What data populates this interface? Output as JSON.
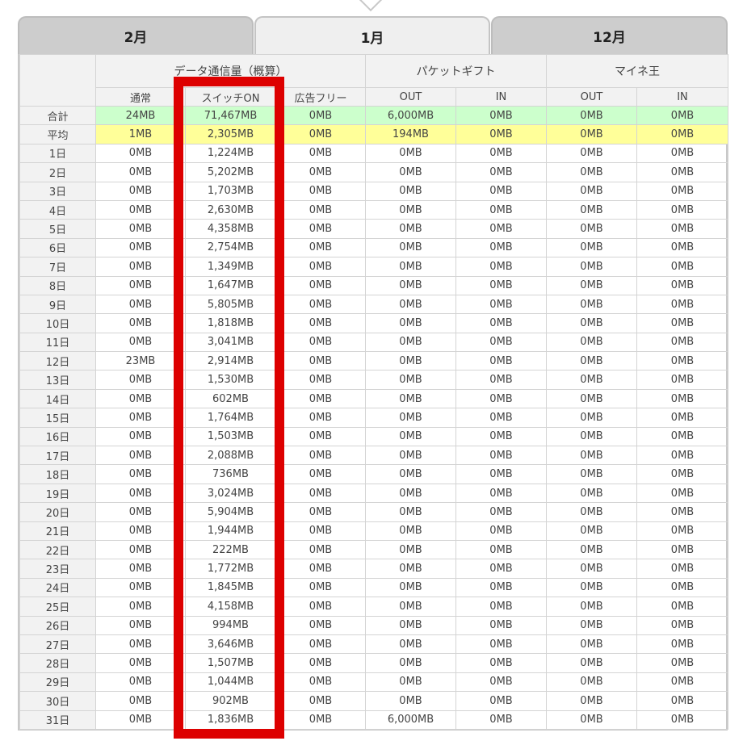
{
  "tabs": [
    {
      "label": "2月",
      "active": false
    },
    {
      "label": "1月",
      "active": true
    },
    {
      "label": "12月",
      "active": false
    }
  ],
  "groups": {
    "data": "データ通信量（概算）",
    "gift": "パケットギフト",
    "mine": "マイネ王"
  },
  "columns": [
    "通常",
    "スイッチON",
    "広告フリー",
    "OUT",
    "IN",
    "OUT",
    "IN"
  ],
  "rows": [
    {
      "label": "合計",
      "kind": "total",
      "values": [
        "24MB",
        "71,467MB",
        "0MB",
        "6,000MB",
        "0MB",
        "0MB",
        "0MB"
      ]
    },
    {
      "label": "平均",
      "kind": "avg",
      "values": [
        "1MB",
        "2,305MB",
        "0MB",
        "194MB",
        "0MB",
        "0MB",
        "0MB"
      ]
    },
    {
      "label": "1日",
      "values": [
        "0MB",
        "1,224MB",
        "0MB",
        "0MB",
        "0MB",
        "0MB",
        "0MB"
      ]
    },
    {
      "label": "2日",
      "values": [
        "0MB",
        "5,202MB",
        "0MB",
        "0MB",
        "0MB",
        "0MB",
        "0MB"
      ]
    },
    {
      "label": "3日",
      "values": [
        "0MB",
        "1,703MB",
        "0MB",
        "0MB",
        "0MB",
        "0MB",
        "0MB"
      ]
    },
    {
      "label": "4日",
      "values": [
        "0MB",
        "2,630MB",
        "0MB",
        "0MB",
        "0MB",
        "0MB",
        "0MB"
      ]
    },
    {
      "label": "5日",
      "values": [
        "0MB",
        "4,358MB",
        "0MB",
        "0MB",
        "0MB",
        "0MB",
        "0MB"
      ]
    },
    {
      "label": "6日",
      "values": [
        "0MB",
        "2,754MB",
        "0MB",
        "0MB",
        "0MB",
        "0MB",
        "0MB"
      ]
    },
    {
      "label": "7日",
      "values": [
        "0MB",
        "1,349MB",
        "0MB",
        "0MB",
        "0MB",
        "0MB",
        "0MB"
      ]
    },
    {
      "label": "8日",
      "values": [
        "0MB",
        "1,647MB",
        "0MB",
        "0MB",
        "0MB",
        "0MB",
        "0MB"
      ]
    },
    {
      "label": "9日",
      "values": [
        "0MB",
        "5,805MB",
        "0MB",
        "0MB",
        "0MB",
        "0MB",
        "0MB"
      ]
    },
    {
      "label": "10日",
      "values": [
        "0MB",
        "1,818MB",
        "0MB",
        "0MB",
        "0MB",
        "0MB",
        "0MB"
      ]
    },
    {
      "label": "11日",
      "values": [
        "0MB",
        "3,041MB",
        "0MB",
        "0MB",
        "0MB",
        "0MB",
        "0MB"
      ]
    },
    {
      "label": "12日",
      "values": [
        "23MB",
        "2,914MB",
        "0MB",
        "0MB",
        "0MB",
        "0MB",
        "0MB"
      ]
    },
    {
      "label": "13日",
      "values": [
        "0MB",
        "1,530MB",
        "0MB",
        "0MB",
        "0MB",
        "0MB",
        "0MB"
      ]
    },
    {
      "label": "14日",
      "values": [
        "0MB",
        "602MB",
        "0MB",
        "0MB",
        "0MB",
        "0MB",
        "0MB"
      ]
    },
    {
      "label": "15日",
      "values": [
        "0MB",
        "1,764MB",
        "0MB",
        "0MB",
        "0MB",
        "0MB",
        "0MB"
      ]
    },
    {
      "label": "16日",
      "values": [
        "0MB",
        "1,503MB",
        "0MB",
        "0MB",
        "0MB",
        "0MB",
        "0MB"
      ]
    },
    {
      "label": "17日",
      "values": [
        "0MB",
        "2,088MB",
        "0MB",
        "0MB",
        "0MB",
        "0MB",
        "0MB"
      ]
    },
    {
      "label": "18日",
      "values": [
        "0MB",
        "736MB",
        "0MB",
        "0MB",
        "0MB",
        "0MB",
        "0MB"
      ]
    },
    {
      "label": "19日",
      "values": [
        "0MB",
        "3,024MB",
        "0MB",
        "0MB",
        "0MB",
        "0MB",
        "0MB"
      ]
    },
    {
      "label": "20日",
      "values": [
        "0MB",
        "5,904MB",
        "0MB",
        "0MB",
        "0MB",
        "0MB",
        "0MB"
      ]
    },
    {
      "label": "21日",
      "values": [
        "0MB",
        "1,944MB",
        "0MB",
        "0MB",
        "0MB",
        "0MB",
        "0MB"
      ]
    },
    {
      "label": "22日",
      "values": [
        "0MB",
        "222MB",
        "0MB",
        "0MB",
        "0MB",
        "0MB",
        "0MB"
      ]
    },
    {
      "label": "23日",
      "values": [
        "0MB",
        "1,772MB",
        "0MB",
        "0MB",
        "0MB",
        "0MB",
        "0MB"
      ]
    },
    {
      "label": "24日",
      "values": [
        "0MB",
        "1,845MB",
        "0MB",
        "0MB",
        "0MB",
        "0MB",
        "0MB"
      ]
    },
    {
      "label": "25日",
      "values": [
        "0MB",
        "4,158MB",
        "0MB",
        "0MB",
        "0MB",
        "0MB",
        "0MB"
      ]
    },
    {
      "label": "26日",
      "values": [
        "0MB",
        "994MB",
        "0MB",
        "0MB",
        "0MB",
        "0MB",
        "0MB"
      ]
    },
    {
      "label": "27日",
      "values": [
        "0MB",
        "3,646MB",
        "0MB",
        "0MB",
        "0MB",
        "0MB",
        "0MB"
      ]
    },
    {
      "label": "28日",
      "values": [
        "0MB",
        "1,507MB",
        "0MB",
        "0MB",
        "0MB",
        "0MB",
        "0MB"
      ]
    },
    {
      "label": "29日",
      "values": [
        "0MB",
        "1,044MB",
        "0MB",
        "0MB",
        "0MB",
        "0MB",
        "0MB"
      ]
    },
    {
      "label": "30日",
      "values": [
        "0MB",
        "902MB",
        "0MB",
        "0MB",
        "0MB",
        "0MB",
        "0MB"
      ]
    },
    {
      "label": "31日",
      "values": [
        "0MB",
        "1,836MB",
        "0MB",
        "6,000MB",
        "0MB",
        "0MB",
        "0MB"
      ]
    }
  ],
  "colors": {
    "highlight": "#dd0000",
    "total_row": "#ccffcc",
    "avg_row": "#ffff99",
    "tab_inactive": "#cdcdcd",
    "tab_active": "#efefef"
  }
}
